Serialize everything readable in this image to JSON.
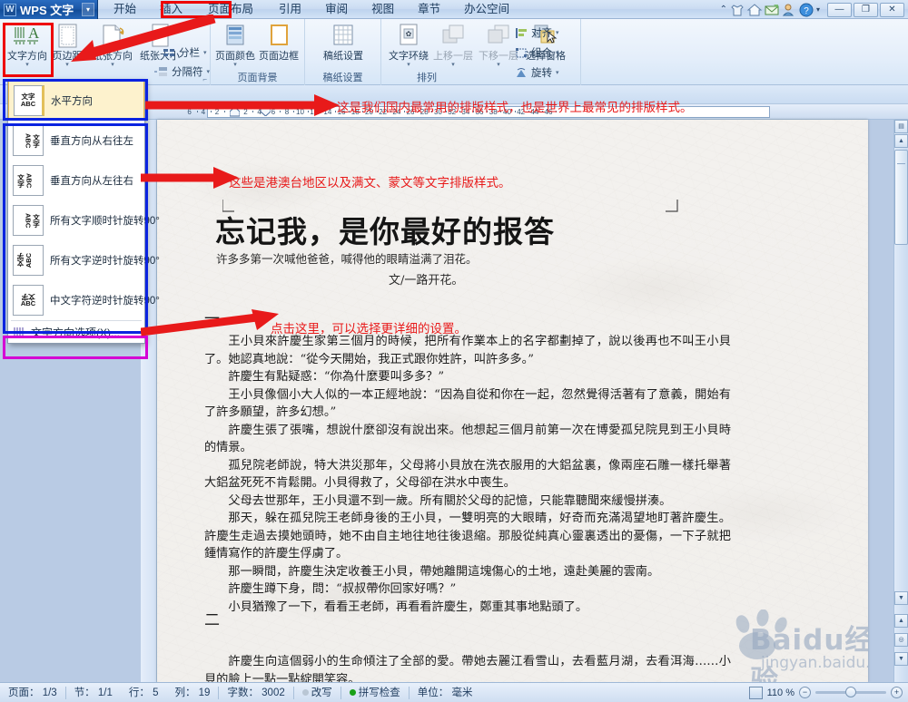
{
  "titlebar": {
    "app_name": "WPS 文字",
    "logo_glyph": "W",
    "dropdown_caret": "▾",
    "menus": [
      "开始",
      "插入",
      "页面布局",
      "引用",
      "审阅",
      "视图",
      "章节",
      "办公空间"
    ],
    "active_menu": "页面布局",
    "right_icons": [
      "collapse-caret",
      "shirt-icon",
      "home-icon",
      "mail-icon",
      "user-icon",
      "help-icon",
      "more-caret"
    ],
    "window_buttons": [
      "—",
      "❐",
      "✕"
    ]
  },
  "ribbon": {
    "groups": [
      {
        "label": "",
        "buttons": [
          "文字方向",
          "页边距",
          "纸张方向",
          "纸张大小"
        ],
        "small": [
          "分栏",
          "分隔符"
        ]
      },
      {
        "label": "页面背景",
        "buttons": [
          "页面颜色",
          "页面边框"
        ]
      },
      {
        "label": "稿纸设置",
        "buttons": [
          "稿纸设置"
        ]
      },
      {
        "label": "排列",
        "buttons": [
          "文字环绕",
          "上移一层",
          "下移一层",
          "选择窗格"
        ],
        "small": [
          "对齐",
          "组合",
          "旋转"
        ]
      }
    ],
    "text_direction_label": "文字方向",
    "margin_label": "页边距",
    "paper_orientation_label": "纸张方向",
    "paper_size_label": "纸张大小",
    "columns_label": "分栏",
    "separator_label": "分隔符",
    "page_color_label": "页面颜色",
    "page_border_label": "页面边框",
    "grid_paper_label": "稿纸设置",
    "text_wrap_label": "文字环绕",
    "bring_forward_label": "上移一层",
    "send_backward_label": "下移一层",
    "selection_pane_label": "选择窗格",
    "align_label": "对齐",
    "group_label": "组合",
    "rotate_label": "旋转",
    "group_page_bg": "页面背景",
    "group_grid": "稿纸设置",
    "group_arrange": "排列"
  },
  "dropdown": {
    "selected_item": {
      "label": "水平方向",
      "glyph_top": "文字",
      "glyph_bottom": "ABC"
    },
    "items": [
      {
        "label": "垂直方向从右往左",
        "glyph_top": "文字",
        "glyph_bottom": "ABC"
      },
      {
        "label": "垂直方向从左往右",
        "glyph_top": "文字",
        "glyph_bottom": "ABC"
      },
      {
        "label": "所有文字顺时针旋转90°",
        "glyph_top": "文字",
        "glyph_bottom": "ABC"
      },
      {
        "label": "所有文字逆时针旋转90°",
        "glyph_top": "文字",
        "glyph_bottom": "ABC"
      },
      {
        "label": "中文字符逆时针旋转90°",
        "glyph_top": "文字",
        "glyph_bottom": "ABC"
      }
    ],
    "option_item": {
      "label": "文字方向选项(X)..."
    }
  },
  "annotations": [
    {
      "id": "a1",
      "text": "这是我们国内最常用的排版样式，也是世界上最常见的排版样式。"
    },
    {
      "id": "a2",
      "text": "这些是港澳台地区以及满文、蒙文等文字排版样式。"
    },
    {
      "id": "a3",
      "text": "点击这里，可以选择更详细的设置。"
    }
  ],
  "ruler": {
    "left_marks": [
      "6",
      "4",
      "2"
    ],
    "right_marks": [
      "2",
      "4",
      "6",
      "8",
      "10",
      "12",
      "14",
      "16",
      "18",
      "20",
      "22",
      "24",
      "26",
      "28",
      "30",
      "32",
      "34",
      "36",
      "38",
      "40",
      "42",
      "44",
      "46"
    ]
  },
  "document": {
    "title": "忘记我，是你最好的报答",
    "subtitle": "许多多第一次喊他爸爸，喊得他的眼睛溢满了泪花。",
    "byline": "文/一路开花。",
    "section_mark_1": "一",
    "section_mark_2": "二",
    "paragraphs": [
      "王小貝來許慶生家第三個月的時候，把所有作業本上的名字都劃掉了，說以後再也不叫王小貝了。她認真地說：“從今天開始，我正式跟你姓許，叫許多多。”",
      "許慶生有點疑惑：“你為什麼要叫多多？”",
      "王小貝像個小大人似的一本正經地說：“因為自從和你在一起，忽然覺得活著有了意義，開始有了許多願望，許多幻想。”",
      "許慶生張了張嘴，想說什麼卻沒有說出來。他想起三個月前第一次在博愛孤兒院見到王小貝時的情景。",
      "孤兒院老師說，特大洪災那年，父母將小貝放在洗衣服用的大鋁盆裏，像兩座石雕一樣托舉著大鋁盆死死不肯鬆開。小貝得救了，父母卻在洪水中喪生。",
      "父母去世那年，王小貝還不到一歲。所有關於父母的記憶，只能靠聽聞來緩慢拼湊。",
      "那天，躲在孤兒院王老師身後的王小貝，一雙明亮的大眼睛，好奇而充滿渴望地盯著許慶生。許慶生走過去摸她頭時，她不由自主地往地往後退縮。那股從純真心靈裏透出的憂傷，一下子就把鍾情寫作的許慶生俘虜了。",
      "那一瞬間，許慶生決定收養王小貝，帶她離開這塊傷心的土地，遠赴美麗的雲南。",
      "許慶生蹲下身，問：“叔叔帶你回家好嗎？”",
      "小貝猶豫了一下，看看王老師，再看看許慶生，鄭重其事地點頭了。"
    ],
    "last_paragraph": "許慶生向這個弱小的生命傾注了全部的愛。帶她去麗江看雪山，去看藍月湖，去看洱海……小貝的臉上一點一點綻開笑容。"
  },
  "watermark": {
    "brand": "Baidu经验",
    "url": "jingyan.baidu.com"
  },
  "statusbar": {
    "page": "页面： 1/3",
    "section": "节： 1/1",
    "row": "行： 5",
    "col": "列： 19",
    "words": "字数： 3002",
    "overwrite": "改写",
    "spellcheck": "拼写检查",
    "unit": "单位： 毫米",
    "zoom": "110 %",
    "zoom_minus": "−",
    "zoom_plus": "+"
  },
  "colors": {
    "accent_red": "#ee0000",
    "accent_blue": "#0b23e0",
    "accent_magenta": "#d400d4",
    "annotation_red": "#e81a1a",
    "ribbon_bg": "#e4eefa",
    "workarea_bg": "#b9cbe4"
  }
}
